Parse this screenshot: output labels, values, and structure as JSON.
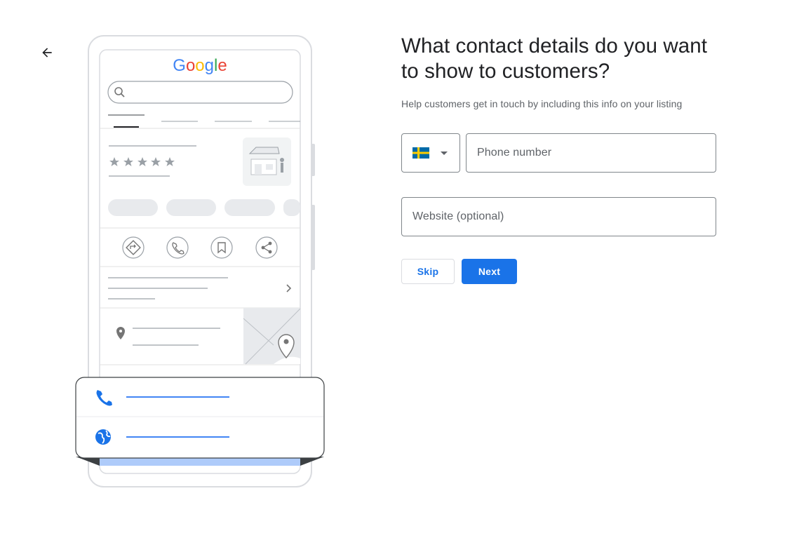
{
  "nav": {
    "back_icon": "arrow-back-icon"
  },
  "illustration": {
    "brand_text": "Google",
    "brand_colors": [
      "#4285F4",
      "#EA4335",
      "#FBBC05",
      "#4285F4",
      "#34A853",
      "#EA4335"
    ],
    "icons": [
      "search-icon",
      "star-icon",
      "storefront-icon",
      "directions-icon",
      "phone-icon",
      "bookmark-icon",
      "share-icon",
      "chevron-right-icon",
      "location-pin-icon",
      "map-pin-icon",
      "globe-icon"
    ],
    "star_count": 5
  },
  "form": {
    "title": "What contact details do you want to show to customers?",
    "subtitle": "Help customers get in touch by including this info on your listing",
    "country_flag": "sweden-flag-icon",
    "phone_placeholder": "Phone number",
    "website_placeholder": "Website (optional)",
    "skip_label": "Skip",
    "next_label": "Next"
  },
  "colors": {
    "primary": "#1a73e8",
    "text": "#202124",
    "secondary_text": "#5f6368",
    "border": "#80868b"
  }
}
